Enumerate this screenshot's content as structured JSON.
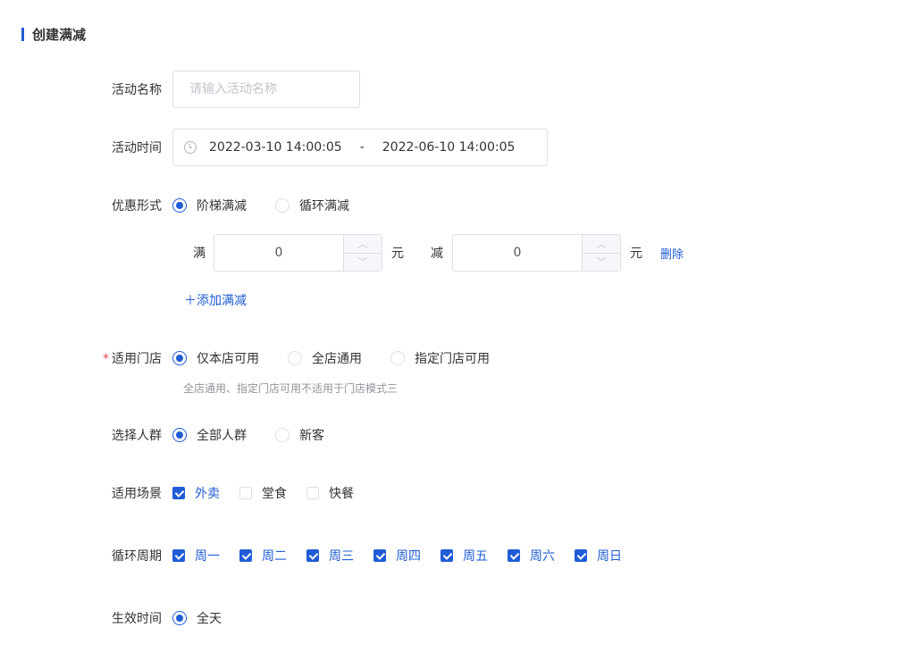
{
  "section_title": "创建满减",
  "form": {
    "name": {
      "label": "活动名称",
      "placeholder": "请输入活动名称",
      "value": ""
    },
    "time": {
      "label": "活动时间",
      "start": "2022-03-10 14:00:05",
      "separator": "-",
      "end": "2022-06-10 14:00:05"
    },
    "discount": {
      "label": "优惠形式",
      "options": [
        "阶梯满减",
        "循环满减"
      ],
      "selected": "阶梯满减",
      "tier": {
        "full_label": "满",
        "full_value": "0",
        "unit1": "元",
        "reduce_label": "减",
        "reduce_value": "0",
        "unit2": "元",
        "delete_label": "删除"
      },
      "add_label": "＋添加满减"
    },
    "store": {
      "label": "适用门店",
      "required_mark": "*",
      "options": [
        "仅本店可用",
        "全店通用",
        "指定门店可用"
      ],
      "selected": "仅本店可用",
      "hint": "全店通用、指定门店可用不适用于门店模式三"
    },
    "crowd": {
      "label": "选择人群",
      "options": [
        "全部人群",
        "新客"
      ],
      "selected": "全部人群"
    },
    "scene": {
      "label": "适用场景",
      "options": [
        "外卖",
        "堂食",
        "快餐"
      ],
      "checked": [
        "外卖"
      ]
    },
    "cycle": {
      "label": "循环周期",
      "options": [
        "周一",
        "周二",
        "周三",
        "周四",
        "周五",
        "周六",
        "周日"
      ],
      "checked": [
        "周一",
        "周二",
        "周三",
        "周四",
        "周五",
        "周六",
        "周日"
      ]
    },
    "effective": {
      "label": "生效时间",
      "options": [
        "全天"
      ],
      "selected": "全天"
    }
  },
  "colors": {
    "primary": "#1f5cd6",
    "required": "#e5484d",
    "border": "#dcdfe6"
  }
}
